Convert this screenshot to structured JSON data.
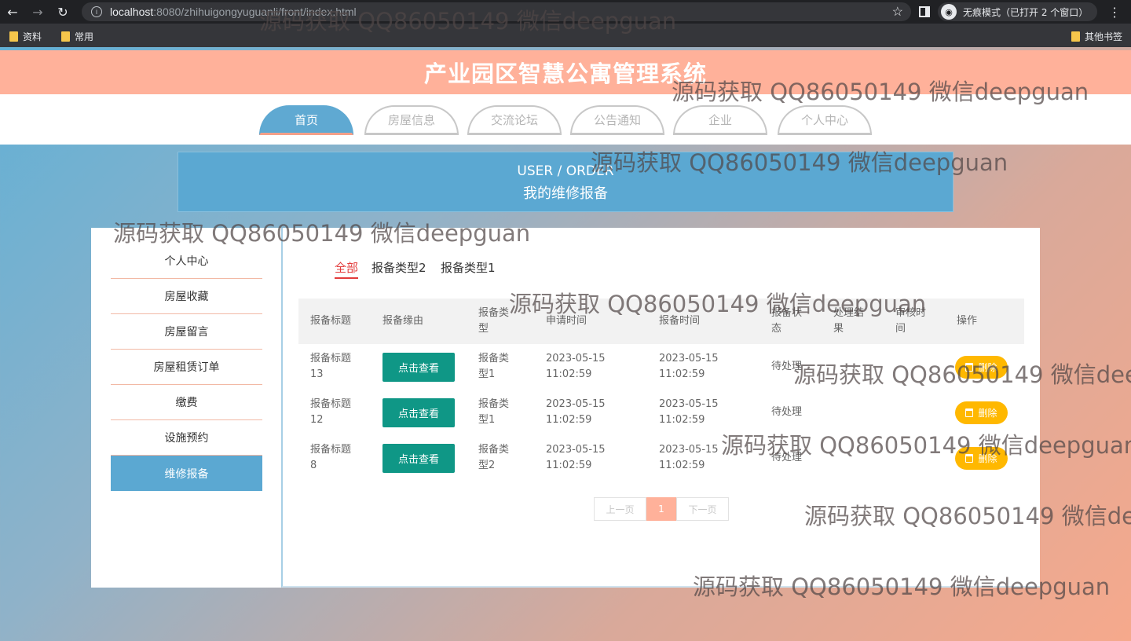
{
  "browser": {
    "url_host": "localhost",
    "url_path": ":8080/zhihuigongyuguanli/front/index.html",
    "incognito_label": "无痕模式（已打开 2 个窗口）",
    "bookmarks": [
      "资料",
      "常用"
    ],
    "other_bookmarks": "其他书签"
  },
  "site": {
    "title": "产业园区智慧公寓管理系统",
    "nav": [
      "首页",
      "房屋信息",
      "交流论坛",
      "公告通知",
      "企业",
      "个人中心"
    ],
    "active_nav": 0
  },
  "banner": {
    "en": "USER / ORDER",
    "cn": "我的维修报备"
  },
  "sidebar": {
    "items": [
      "个人中心",
      "房屋收藏",
      "房屋留言",
      "房屋租赁订单",
      "缴费",
      "设施预约",
      "维修报备"
    ],
    "active_index": 6
  },
  "filters": {
    "items": [
      "全部",
      "报备类型2",
      "报备类型1"
    ],
    "active_index": 0
  },
  "table": {
    "headers": [
      "报备标题",
      "报备缘由",
      "报备类\n型",
      "申请时间",
      "报备时间",
      "报备状\n态",
      "处理结\n果",
      "审核时\n间",
      "操作"
    ],
    "rows": [
      {
        "title": "报备标题\n13",
        "reason": "点击查看",
        "type": "报备类\n型1",
        "apply_time": "2023-05-15\n11:02:59",
        "report_time": "2023-05-15\n11:02:59",
        "status": "待处理",
        "result": "",
        "audit_time": "",
        "action": "删除"
      },
      {
        "title": "报备标题\n12",
        "reason": "点击查看",
        "type": "报备类\n型1",
        "apply_time": "2023-05-15\n11:02:59",
        "report_time": "2023-05-15\n11:02:59",
        "status": "待处理",
        "result": "",
        "audit_time": "",
        "action": "删除"
      },
      {
        "title": "报备标题\n8",
        "reason": "点击查看",
        "type": "报备类\n型2",
        "apply_time": "2023-05-15\n11:02:59",
        "report_time": "2023-05-15\n11:02:59",
        "status": "待处理",
        "result": "",
        "audit_time": "",
        "action": "删除"
      }
    ]
  },
  "pager": {
    "prev": "上一页",
    "current": "1",
    "next": "下一页"
  },
  "watermark": "源码获取 QQ86050149 微信deepguan",
  "colors": {
    "title_bar": "#ffb19a",
    "accent_blue": "#5ba8d2",
    "view_button": "#0f9786",
    "delete_button": "#ffb800",
    "active_filter": "#e23b3b"
  }
}
